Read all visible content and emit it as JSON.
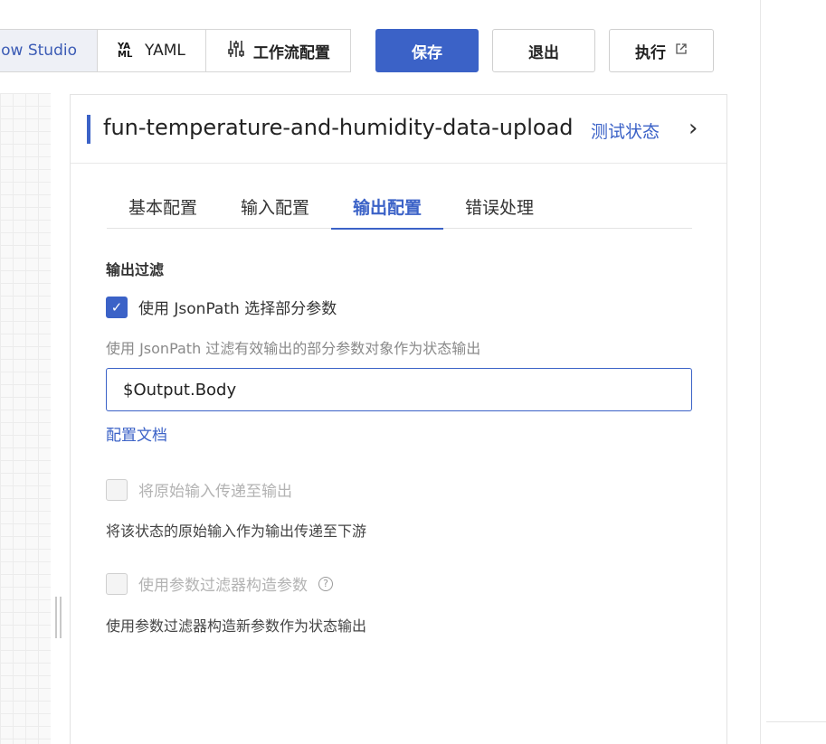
{
  "toolbar": {
    "tabs": [
      {
        "label": "low Studio"
      },
      {
        "label": "YAML"
      },
      {
        "label": "工作流配置"
      }
    ],
    "save_label": "保存",
    "exit_label": "退出",
    "run_label": "执行"
  },
  "panel": {
    "title": "fun-temperature-and-humidity-data-upload",
    "test_status_link": "测试状态",
    "tabs": [
      {
        "label": "基本配置"
      },
      {
        "label": "输入配置"
      },
      {
        "label": "输出配置",
        "active": true
      },
      {
        "label": "错误处理"
      }
    ],
    "section_title": "输出过滤",
    "jsonpath": {
      "label": "使用 JsonPath 选择部分参数",
      "checked": true,
      "description": "使用 JsonPath 过滤有效输出的部分参数对象作为状态输出",
      "value": "$Output.Body"
    },
    "doc_link": "配置文档",
    "pass_input": {
      "label": "将原始输入传递至输出",
      "checked": false,
      "description": "将该状态的原始输入作为输出传递至下游"
    },
    "param_filter": {
      "label": "使用参数过滤器构造参数",
      "checked": false,
      "description": "使用参数过滤器构造新参数作为状态输出"
    }
  },
  "colors": {
    "accent": "#3b62c7",
    "disabled_text": "#b3b3b3"
  }
}
